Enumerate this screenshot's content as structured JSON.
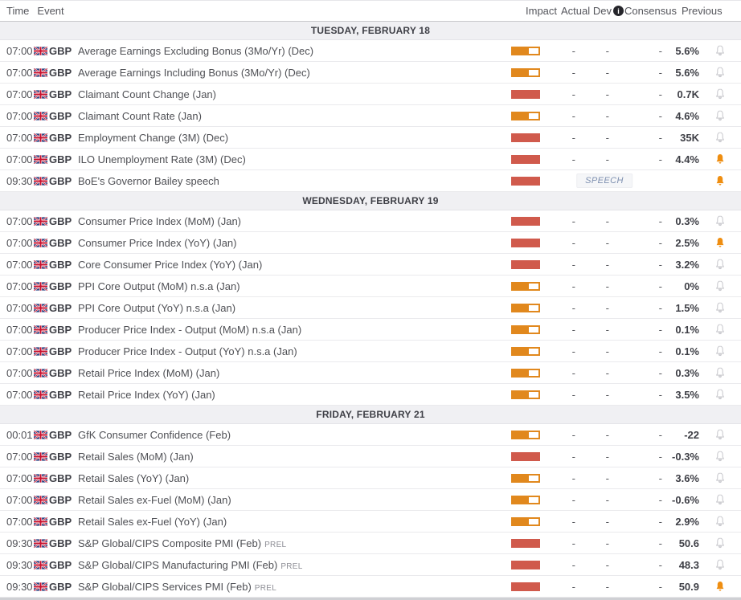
{
  "header": {
    "columns": {
      "time": "Time",
      "event": "Event",
      "impact": "Impact",
      "actual": "Actual",
      "dev": "Dev",
      "consensus": "Consensus",
      "previous": "Previous"
    },
    "dev_info_icon": "i"
  },
  "colors": {
    "impact_high": "#d05a4c",
    "impact_medium": "#e1881d",
    "bell_active": "#ef8e11"
  },
  "sections": [
    {
      "title": "TUESDAY, FEBRUARY 18",
      "rows": [
        {
          "time": "07:00",
          "currency": "GBP",
          "event": "Average Earnings Excluding Bonus (3Mo/Yr) (Dec)",
          "suffix": "",
          "impact": "medium",
          "actual": "-",
          "dev": "-",
          "consensus": "-",
          "previous": "5.6%",
          "bell": "inactive",
          "badge": ""
        },
        {
          "time": "07:00",
          "currency": "GBP",
          "event": "Average Earnings Including Bonus (3Mo/Yr) (Dec)",
          "suffix": "",
          "impact": "medium",
          "actual": "-",
          "dev": "-",
          "consensus": "-",
          "previous": "5.6%",
          "bell": "inactive",
          "badge": ""
        },
        {
          "time": "07:00",
          "currency": "GBP",
          "event": "Claimant Count Change (Jan)",
          "suffix": "",
          "impact": "high",
          "actual": "-",
          "dev": "-",
          "consensus": "-",
          "previous": "0.7K",
          "bell": "inactive",
          "badge": ""
        },
        {
          "time": "07:00",
          "currency": "GBP",
          "event": "Claimant Count Rate (Jan)",
          "suffix": "",
          "impact": "medium",
          "actual": "-",
          "dev": "-",
          "consensus": "-",
          "previous": "4.6%",
          "bell": "inactive",
          "badge": ""
        },
        {
          "time": "07:00",
          "currency": "GBP",
          "event": "Employment Change (3M) (Dec)",
          "suffix": "",
          "impact": "high",
          "actual": "-",
          "dev": "-",
          "consensus": "-",
          "previous": "35K",
          "bell": "inactive",
          "badge": ""
        },
        {
          "time": "07:00",
          "currency": "GBP",
          "event": "ILO Unemployment Rate (3M) (Dec)",
          "suffix": "",
          "impact": "high",
          "actual": "-",
          "dev": "-",
          "consensus": "-",
          "previous": "4.4%",
          "bell": "active",
          "badge": ""
        },
        {
          "time": "09:30",
          "currency": "GBP",
          "event": "BoE's Governor Bailey speech",
          "suffix": "",
          "impact": "high",
          "actual": "",
          "dev": "",
          "consensus": "",
          "previous": "",
          "bell": "active",
          "badge": "SPEECH"
        }
      ]
    },
    {
      "title": "WEDNESDAY, FEBRUARY 19",
      "rows": [
        {
          "time": "07:00",
          "currency": "GBP",
          "event": "Consumer Price Index (MoM) (Jan)",
          "suffix": "",
          "impact": "high",
          "actual": "-",
          "dev": "-",
          "consensus": "-",
          "previous": "0.3%",
          "bell": "inactive",
          "badge": ""
        },
        {
          "time": "07:00",
          "currency": "GBP",
          "event": "Consumer Price Index (YoY) (Jan)",
          "suffix": "",
          "impact": "high",
          "actual": "-",
          "dev": "-",
          "consensus": "-",
          "previous": "2.5%",
          "bell": "active",
          "badge": ""
        },
        {
          "time": "07:00",
          "currency": "GBP",
          "event": "Core Consumer Price Index (YoY) (Jan)",
          "suffix": "",
          "impact": "high",
          "actual": "-",
          "dev": "-",
          "consensus": "-",
          "previous": "3.2%",
          "bell": "inactive",
          "badge": ""
        },
        {
          "time": "07:00",
          "currency": "GBP",
          "event": "PPI Core Output (MoM) n.s.a (Jan)",
          "suffix": "",
          "impact": "medium",
          "actual": "-",
          "dev": "-",
          "consensus": "-",
          "previous": "0%",
          "bell": "inactive",
          "badge": ""
        },
        {
          "time": "07:00",
          "currency": "GBP",
          "event": "PPI Core Output (YoY) n.s.a (Jan)",
          "suffix": "",
          "impact": "medium",
          "actual": "-",
          "dev": "-",
          "consensus": "-",
          "previous": "1.5%",
          "bell": "inactive",
          "badge": ""
        },
        {
          "time": "07:00",
          "currency": "GBP",
          "event": "Producer Price Index - Output (MoM) n.s.a (Jan)",
          "suffix": "",
          "impact": "medium",
          "actual": "-",
          "dev": "-",
          "consensus": "-",
          "previous": "0.1%",
          "bell": "inactive",
          "badge": ""
        },
        {
          "time": "07:00",
          "currency": "GBP",
          "event": "Producer Price Index - Output (YoY) n.s.a (Jan)",
          "suffix": "",
          "impact": "medium",
          "actual": "-",
          "dev": "-",
          "consensus": "-",
          "previous": "0.1%",
          "bell": "inactive",
          "badge": ""
        },
        {
          "time": "07:00",
          "currency": "GBP",
          "event": "Retail Price Index (MoM) (Jan)",
          "suffix": "",
          "impact": "medium",
          "actual": "-",
          "dev": "-",
          "consensus": "-",
          "previous": "0.3%",
          "bell": "inactive",
          "badge": ""
        },
        {
          "time": "07:00",
          "currency": "GBP",
          "event": "Retail Price Index (YoY) (Jan)",
          "suffix": "",
          "impact": "medium",
          "actual": "-",
          "dev": "-",
          "consensus": "-",
          "previous": "3.5%",
          "bell": "inactive",
          "badge": ""
        }
      ]
    },
    {
      "title": "FRIDAY, FEBRUARY 21",
      "rows": [
        {
          "time": "00:01",
          "currency": "GBP",
          "event": "GfK Consumer Confidence (Feb)",
          "suffix": "",
          "impact": "medium",
          "actual": "-",
          "dev": "-",
          "consensus": "-",
          "previous": "-22",
          "bell": "inactive",
          "badge": ""
        },
        {
          "time": "07:00",
          "currency": "GBP",
          "event": "Retail Sales (MoM) (Jan)",
          "suffix": "",
          "impact": "high",
          "actual": "-",
          "dev": "-",
          "consensus": "-",
          "previous": "-0.3%",
          "bell": "inactive",
          "badge": ""
        },
        {
          "time": "07:00",
          "currency": "GBP",
          "event": "Retail Sales (YoY) (Jan)",
          "suffix": "",
          "impact": "medium",
          "actual": "-",
          "dev": "-",
          "consensus": "-",
          "previous": "3.6%",
          "bell": "inactive",
          "badge": ""
        },
        {
          "time": "07:00",
          "currency": "GBP",
          "event": "Retail Sales ex-Fuel (MoM) (Jan)",
          "suffix": "",
          "impact": "medium",
          "actual": "-",
          "dev": "-",
          "consensus": "-",
          "previous": "-0.6%",
          "bell": "inactive",
          "badge": ""
        },
        {
          "time": "07:00",
          "currency": "GBP",
          "event": "Retail Sales ex-Fuel (YoY) (Jan)",
          "suffix": "",
          "impact": "medium",
          "actual": "-",
          "dev": "-",
          "consensus": "-",
          "previous": "2.9%",
          "bell": "inactive",
          "badge": ""
        },
        {
          "time": "09:30",
          "currency": "GBP",
          "event": "S&P Global/CIPS Composite PMI (Feb)",
          "suffix": "PREL",
          "impact": "high",
          "actual": "-",
          "dev": "-",
          "consensus": "-",
          "previous": "50.6",
          "bell": "inactive",
          "badge": ""
        },
        {
          "time": "09:30",
          "currency": "GBP",
          "event": "S&P Global/CIPS Manufacturing PMI (Feb)",
          "suffix": "PREL",
          "impact": "high",
          "actual": "-",
          "dev": "-",
          "consensus": "-",
          "previous": "48.3",
          "bell": "inactive",
          "badge": ""
        },
        {
          "time": "09:30",
          "currency": "GBP",
          "event": "S&P Global/CIPS Services PMI (Feb)",
          "suffix": "PREL",
          "impact": "high",
          "actual": "-",
          "dev": "-",
          "consensus": "-",
          "previous": "50.9",
          "bell": "active",
          "badge": ""
        }
      ]
    }
  ]
}
